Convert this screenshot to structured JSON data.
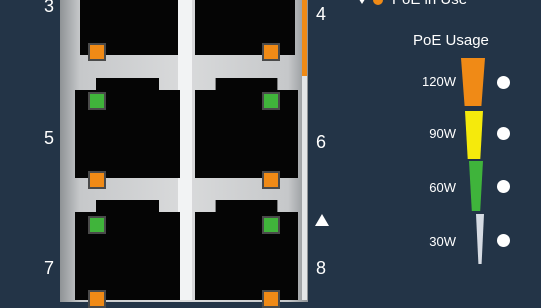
{
  "ports": {
    "p3": "3",
    "p4": "4",
    "p5": "5",
    "p6": "6",
    "p7": "7",
    "p8": "8"
  },
  "legend": {
    "top_partial": "PoE in Use",
    "title": "PoE Usage",
    "levels": [
      {
        "label": "120W",
        "color": "#f08a16"
      },
      {
        "label": "90W",
        "color": "#f5ea0c"
      },
      {
        "label": "60W",
        "color": "#3fb43b"
      },
      {
        "label": "30W",
        "color": "#d6dbe3"
      }
    ]
  },
  "colors": {
    "background": "#233447",
    "led_orange": "#f08a16",
    "led_green": "#40b43b"
  }
}
